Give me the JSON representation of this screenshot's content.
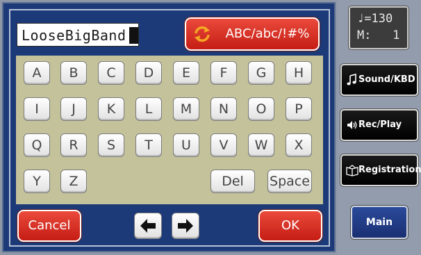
{
  "name_entry": {
    "value": "LooseBigBand"
  },
  "mode_button": {
    "label": "ABC/abc/!#%",
    "icon": "cycle-icon"
  },
  "keys": [
    {
      "label": "A"
    },
    {
      "label": "B"
    },
    {
      "label": "C"
    },
    {
      "label": "D"
    },
    {
      "label": "E"
    },
    {
      "label": "F"
    },
    {
      "label": "G"
    },
    {
      "label": "H"
    },
    {
      "label": "I"
    },
    {
      "label": "J"
    },
    {
      "label": "K"
    },
    {
      "label": "L"
    },
    {
      "label": "M"
    },
    {
      "label": "N"
    },
    {
      "label": "O"
    },
    {
      "label": "P"
    },
    {
      "label": "Q"
    },
    {
      "label": "R"
    },
    {
      "label": "S"
    },
    {
      "label": "T"
    },
    {
      "label": "U"
    },
    {
      "label": "V"
    },
    {
      "label": "W"
    },
    {
      "label": "X"
    },
    {
      "label": "Y"
    },
    {
      "label": "Z"
    }
  ],
  "edit_keys": {
    "delete": "Del",
    "space": "Space"
  },
  "footer": {
    "cancel": "Cancel",
    "ok": "OK",
    "left_arrow": "left-arrow-icon",
    "right_arrow": "right-arrow-icon"
  },
  "tempo": {
    "line1": "♩=130",
    "line2": "M:   1"
  },
  "side_buttons": {
    "sound": "Sound/KBD",
    "rec": "Rec/Play",
    "registration": "Registration",
    "main": "Main"
  },
  "colors": {
    "accent_red": "#d9302a",
    "panel_blue": "#1c3a78",
    "keypad_bg": "#c4c29b"
  }
}
